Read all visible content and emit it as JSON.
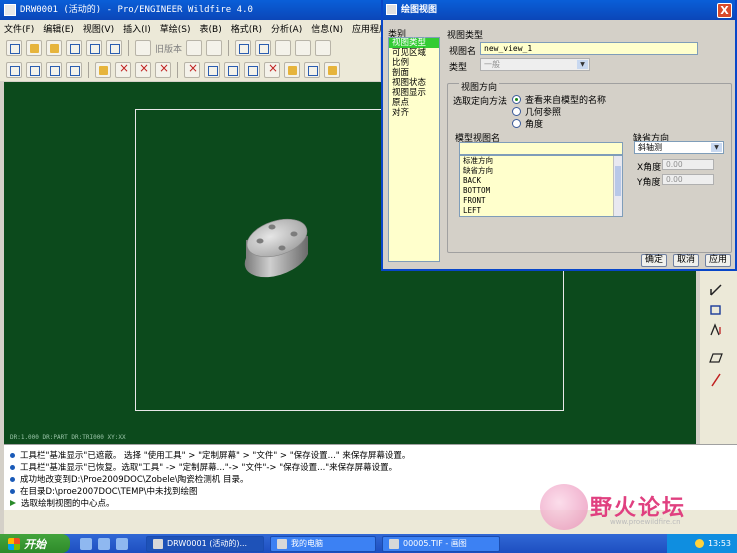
{
  "app": {
    "title": "DRW0001 (活动的) - Pro/ENGINEER Wildfire 4.0"
  },
  "menubar": {
    "items": [
      "文件(F)",
      "编辑(E)",
      "视图(V)",
      "插入(I)",
      "草绘(S)",
      "表(B)",
      "格式(R)",
      "分析(A)",
      "信息(N)",
      "应用程序"
    ]
  },
  "toolbar": {
    "old_version_label": "旧版本"
  },
  "canvas": {
    "status_text": "DR:1.000   DR:PART  DR:TRI000   XY:XX",
    "background_color": "#0c4a1c"
  },
  "messages": [
    {
      "text": "工具栏\"基准显示\"已遮蔽。  选择 \"使用工具\" > \"定制屏幕\"  > \"文件\" > \"保存设置...\" 来保存屏幕设置。",
      "kind": "info"
    },
    {
      "text": "工具栏\"基准显示\"已恢复。选取\"工具\" -> \"定制屏幕...\"->  \"文件\"-> \"保存设置...\"来保存屏幕设置。",
      "kind": "info"
    },
    {
      "text": "成功地改变到D:\\Proe2009DOC\\Zobele\\陶瓷检测机 目录。",
      "kind": "info"
    },
    {
      "text": "在目录D:\\proe2007DOC\\TEMP\\中未找到绘图",
      "kind": "info"
    },
    {
      "text": "选取绘制视图的中心点。",
      "kind": "prompt"
    }
  ],
  "watermark": {
    "title": "野火论坛",
    "url": "www.proewildfire.cn"
  },
  "taskbar": {
    "start_label": "开始",
    "tasks": [
      {
        "label": "DRW0001 (活动的)...",
        "active": true
      },
      {
        "label": "我的电脑",
        "active": false
      },
      {
        "label": "00005.TIF - 画图",
        "active": false
      }
    ],
    "clock": "13:53"
  },
  "dialog": {
    "title": "绘图视图",
    "close_label": "X",
    "category_label": "类别",
    "categories": [
      {
        "label": "视图类型",
        "selected": true
      },
      {
        "label": "可见区域",
        "selected": false
      },
      {
        "label": "比例",
        "selected": false
      },
      {
        "label": "剖面",
        "selected": false
      },
      {
        "label": "视图状态",
        "selected": false
      },
      {
        "label": "视图显示",
        "selected": false
      },
      {
        "label": "原点",
        "selected": false
      },
      {
        "label": "对齐",
        "selected": false
      }
    ],
    "view_type_label": "视图类型",
    "view_name_label": "视图名",
    "view_name_value": "new_view_1",
    "type_label": "类型",
    "type_value": "一般",
    "orientation_label": "视图方向",
    "method_label": "选取定向方法",
    "methods": [
      {
        "label": "查看来自模型的名称",
        "checked": true
      },
      {
        "label": "几何参照",
        "checked": false
      },
      {
        "label": "角度",
        "checked": false
      }
    ],
    "model_view_name_label": "模型视图名",
    "model_view_names": [
      "标准方向",
      "缺省方向",
      "BACK",
      "BOTTOM",
      "FRONT",
      "LEFT"
    ],
    "default_orientation_label": "缺省方向",
    "default_orientation_value": "斜轴测",
    "x_angle_label": "X角度",
    "x_angle_value": "0.00",
    "y_angle_label": "Y角度",
    "y_angle_value": "0.00",
    "ok_label": "确定",
    "cancel_label": "取消",
    "apply_label": "应用"
  }
}
